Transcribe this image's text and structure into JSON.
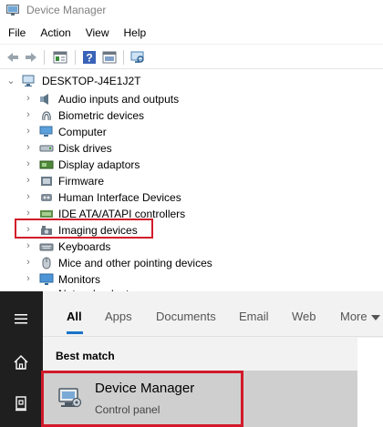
{
  "window": {
    "title": "Device Manager",
    "menu": [
      "File",
      "Action",
      "View",
      "Help"
    ],
    "toolbar_icons": [
      "back-arrow-icon",
      "forward-arrow-icon",
      "properties-icon",
      "help-icon",
      "update-driver-icon",
      "scan-hardware-icon"
    ]
  },
  "tree": {
    "root": "DESKTOP-J4E1J2T",
    "items": [
      {
        "label": "Audio inputs and outputs",
        "icon": "speaker-icon"
      },
      {
        "label": "Biometric devices",
        "icon": "fingerprint-icon"
      },
      {
        "label": "Computer",
        "icon": "computer-icon"
      },
      {
        "label": "Disk drives",
        "icon": "disk-drive-icon"
      },
      {
        "label": "Display adaptors",
        "icon": "display-adapter-icon"
      },
      {
        "label": "Firmware",
        "icon": "firmware-icon"
      },
      {
        "label": "Human Interface Devices",
        "icon": "hid-icon"
      },
      {
        "label": "IDE ATA/ATAPI controllers",
        "icon": "ide-controller-icon"
      },
      {
        "label": "Imaging devices",
        "icon": "camera-icon"
      },
      {
        "label": "Keyboards",
        "icon": "keyboard-icon"
      },
      {
        "label": "Mice and other pointing devices",
        "icon": "mouse-icon"
      },
      {
        "label": "Monitors",
        "icon": "monitor-icon"
      }
    ],
    "highlighted_item": "Imaging devices"
  },
  "search": {
    "tabs": [
      "All",
      "Apps",
      "Documents",
      "Email",
      "Web",
      "More"
    ],
    "active_tab": "All",
    "section_label": "Best match",
    "result": {
      "title": "Device Manager",
      "subtitle": "Control panel"
    }
  },
  "colors": {
    "highlight": "#d11a2a",
    "accent": "#1a73c8",
    "sidebar": "#1f1f1f"
  }
}
